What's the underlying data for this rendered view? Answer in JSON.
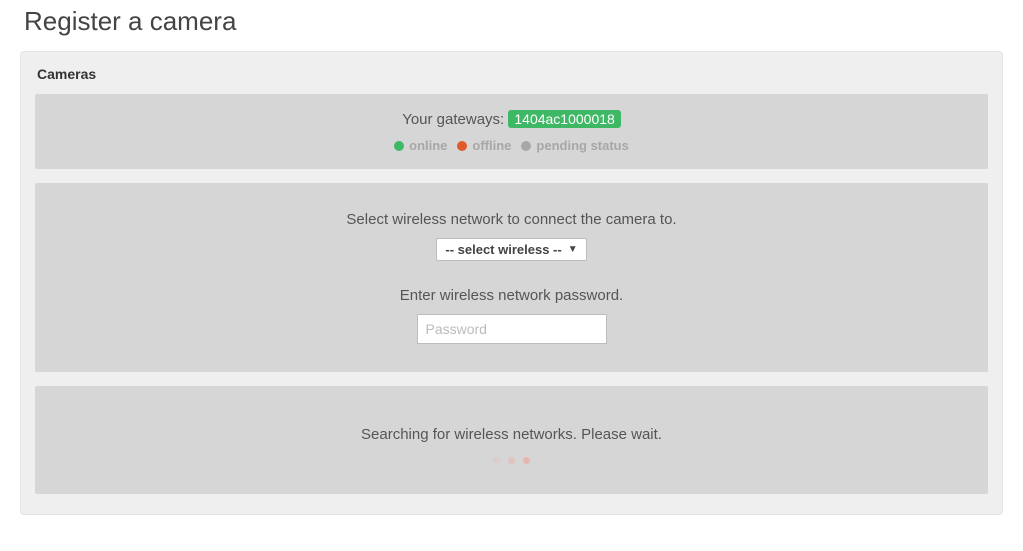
{
  "page": {
    "title": "Register a camera"
  },
  "panel": {
    "title": "Cameras"
  },
  "gateway": {
    "label": "Your gateways:",
    "id": "1404ac1000018",
    "legend": {
      "online": "online",
      "offline": "offline",
      "pending": "pending status"
    }
  },
  "wifi": {
    "select_prompt": "Select wireless network to connect the camera to.",
    "select_placeholder": "-- select wireless --",
    "password_prompt": "Enter wireless network password.",
    "password_placeholder": "Password"
  },
  "status": {
    "searching": "Searching for wireless networks. Please wait."
  }
}
